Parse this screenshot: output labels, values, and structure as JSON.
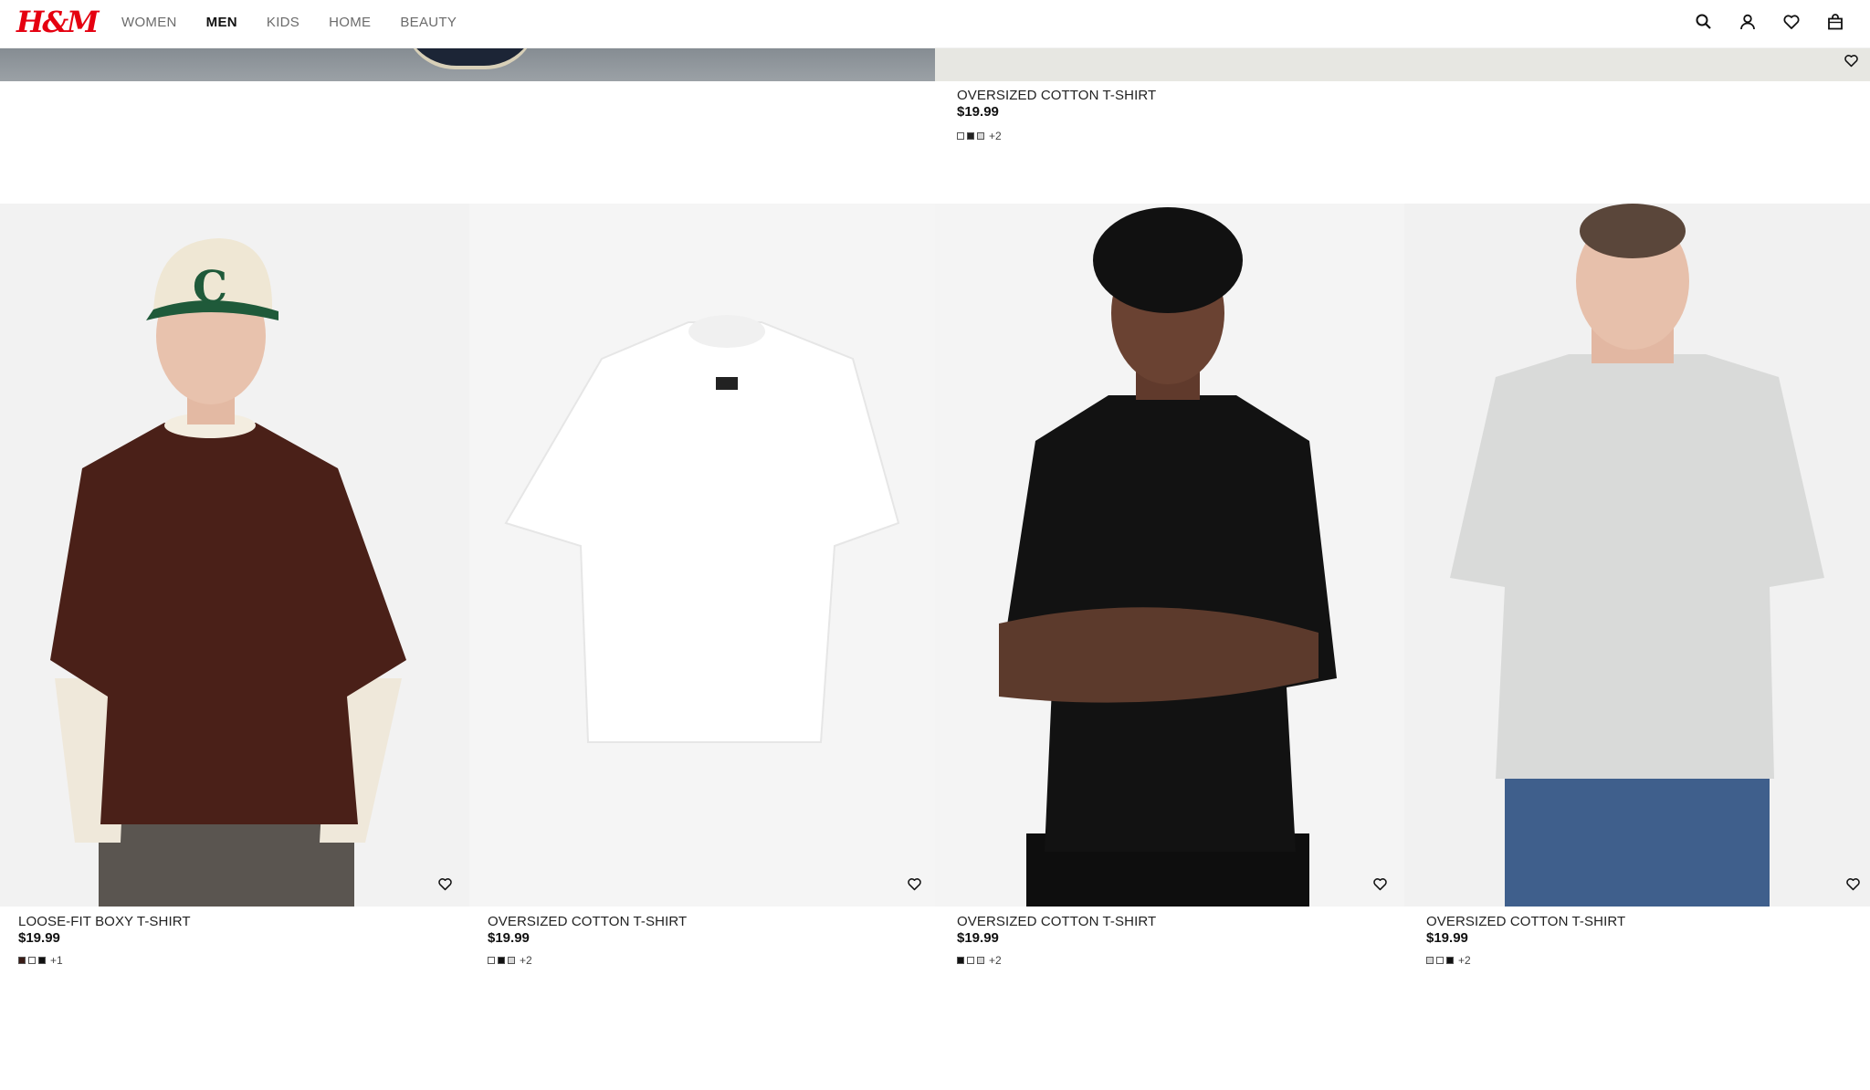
{
  "header": {
    "logo": "H&M",
    "nav": [
      "WOMEN",
      "MEN",
      "KIDS",
      "HOME",
      "BEAUTY"
    ],
    "active_nav": "MEN",
    "icons": [
      "search-icon",
      "account-icon",
      "favorites-icon",
      "bag-icon"
    ]
  },
  "colors": {
    "brand": "#e50010",
    "brown": "#4a2018",
    "white_tee": "#fdfdfd",
    "black_tee": "#111111",
    "grey_tee": "#d9dad9"
  },
  "top_row": {
    "right_product": {
      "title": "OVERSIZED COTTON T-SHIRT",
      "price": "$19.99",
      "swatches": [
        "#ffffff",
        "#222222",
        "#d8d8d8"
      ],
      "more": "+2"
    }
  },
  "products": [
    {
      "title": "LOOSE-FIT BOXY T-SHIRT",
      "price": "$19.99",
      "swatches": [
        "#3a1c16",
        "#ffffff",
        "#111111"
      ],
      "more": "+1"
    },
    {
      "title": "OVERSIZED COTTON T-SHIRT",
      "price": "$19.99",
      "swatches": [
        "#ffffff",
        "#111111",
        "#d8d8d8"
      ],
      "more": "+2"
    },
    {
      "title": "OVERSIZED COTTON T-SHIRT",
      "price": "$19.99",
      "swatches": [
        "#111111",
        "#ffffff",
        "#d8d8d8"
      ],
      "more": "+2"
    },
    {
      "title": "OVERSIZED COTTON T-SHIRT",
      "price": "$19.99",
      "swatches": [
        "#d8d8d8",
        "#ffffff",
        "#111111"
      ],
      "more": "+2"
    }
  ]
}
